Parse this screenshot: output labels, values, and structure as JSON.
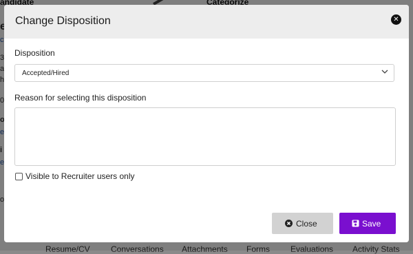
{
  "background": {
    "header_left": "andidate",
    "header_right": "Categorize",
    "fragments": [
      "e",
      "c",
      "3",
      "a",
      "hi",
      "07",
      "o",
      "e",
      "i",
      "e",
      "o"
    ],
    "tabs": [
      "Resume/CV",
      "Conversations",
      "Attachments",
      "Forms",
      "Evaluations",
      "Activity Stats"
    ]
  },
  "modal": {
    "title": "Change Disposition",
    "close_icon": "close-circle-icon",
    "disposition_label": "Disposition",
    "disposition_value": "Accepted/Hired",
    "reason_label": "Reason for selecting this disposition",
    "reason_value": "",
    "checkbox_label": "Visible to Recruiter users only",
    "checkbox_checked": false,
    "close_button": "Close",
    "save_button": "Save"
  },
  "colors": {
    "header_bg": "#ededed",
    "save_bg": "#7a0fcf",
    "close_bg": "#d2d2d2",
    "overlay": "rgba(0,0,0,0.5)"
  }
}
